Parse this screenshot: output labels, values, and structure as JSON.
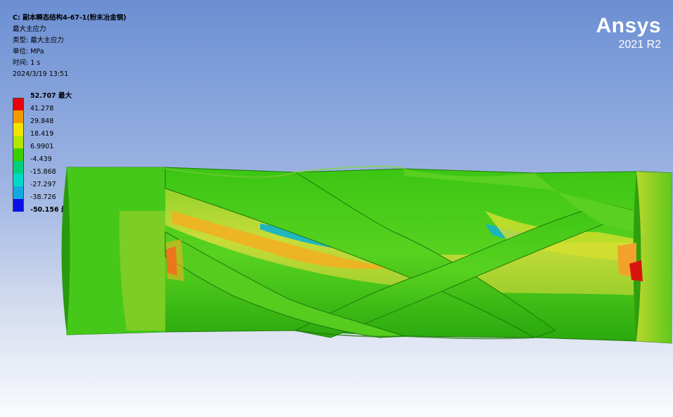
{
  "info": {
    "title": "C: 副本瞬态结构4-67-1(粉末冶金钢)",
    "result": "最大主应力",
    "type_line": "类型: 最大主应力",
    "unit_line": "单位: MPa",
    "time_line": "时间: 1 s",
    "date_line": "2024/3/19 13:51"
  },
  "brand": {
    "name": "Ansys",
    "version": "2021 R2"
  },
  "legend": {
    "max_tag": "最大",
    "min_tag": "最小",
    "entries": [
      {
        "value": "52.707",
        "color": "#e8000b"
      },
      {
        "value": "41.278",
        "color": "#f29a00"
      },
      {
        "value": "29.848",
        "color": "#f2e400"
      },
      {
        "value": "18.419",
        "color": "#b4e600"
      },
      {
        "value": "6.9901",
        "color": "#39d000"
      },
      {
        "value": "-4.439",
        "color": "#00d07b"
      },
      {
        "value": "-15.868",
        "color": "#00d9c7"
      },
      {
        "value": "-27.297",
        "color": "#14a8e0"
      },
      {
        "value": "-38.726",
        "color": "#0c10e6"
      },
      {
        "value": "-50.156",
        "color": ""
      }
    ]
  }
}
